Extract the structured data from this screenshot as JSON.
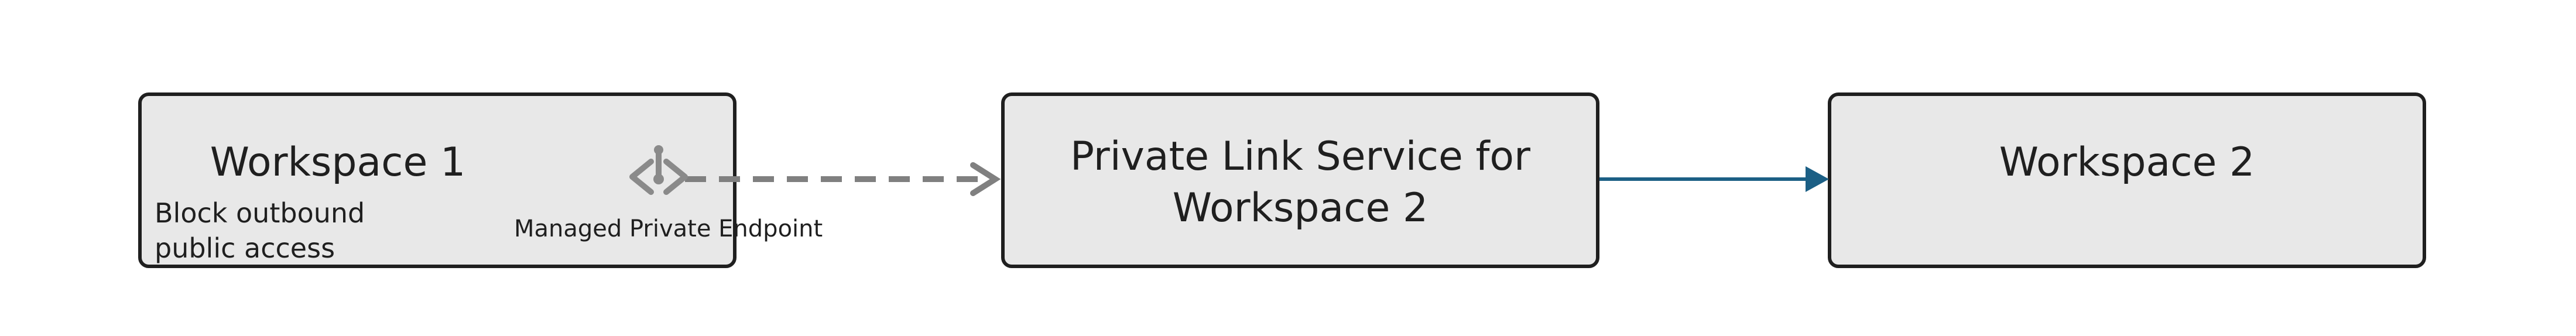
{
  "nodes": {
    "workspace1": {
      "title": "Workspace 1",
      "note_line1": "Block outbound",
      "note_line2": "public access"
    },
    "private_link": {
      "title_line1": "Private Link Service for",
      "title_line2": "Workspace 2"
    },
    "workspace2": {
      "title": "Workspace 2"
    }
  },
  "endpoint": {
    "label": "Managed Private Endpoint",
    "icon": "private-endpoint-icon"
  },
  "edges": [
    {
      "from": "workspace1",
      "to": "private_link",
      "style": "dashed",
      "color": "#808080"
    },
    {
      "from": "private_link",
      "to": "workspace2",
      "style": "solid",
      "color": "#1b5f85"
    }
  ],
  "colors": {
    "box_fill": "#e8e8e8",
    "box_border": "#1f1f1f",
    "dashed_edge": "#808080",
    "solid_edge": "#1b5f85",
    "icon": "#8a8a8a"
  }
}
